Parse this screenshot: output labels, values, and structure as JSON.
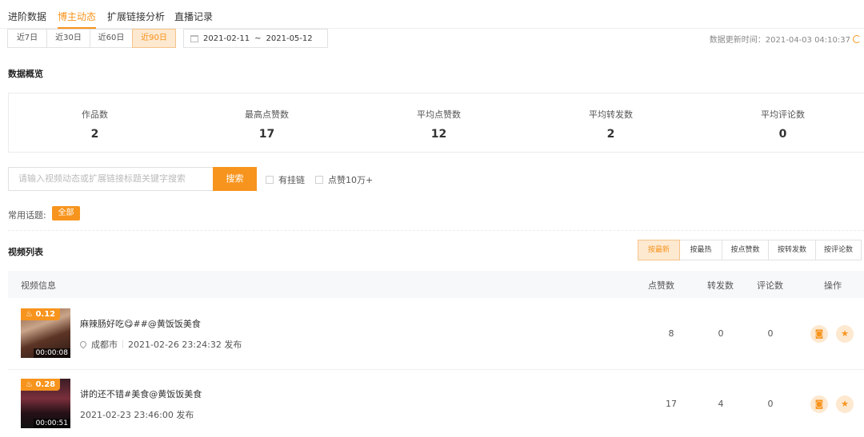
{
  "tabs": [
    "进阶数据",
    "博主动态",
    "扩展链接分析",
    "直播记录"
  ],
  "active_tab": 1,
  "date_ranges": [
    "近7日",
    "近30日",
    "近60日",
    "近90日"
  ],
  "active_range": 3,
  "date_range": {
    "start": "2021-02-11",
    "sep": "~",
    "end": "2021-05-12"
  },
  "update_time": "数据更新时间：2021-04-03 04:10:37",
  "overview": {
    "title": "数据概览",
    "items": [
      {
        "label": "作品数",
        "value": "2"
      },
      {
        "label": "最高点赞数",
        "value": "17"
      },
      {
        "label": "平均点赞数",
        "value": "12"
      },
      {
        "label": "平均转发数",
        "value": "2"
      },
      {
        "label": "平均评论数",
        "value": "0"
      }
    ]
  },
  "search": {
    "placeholder": "请输入视频动态或扩展链接标题关键字搜索",
    "button": "搜索",
    "filter_link": "有挂链",
    "filter_likes": "点赞10万+"
  },
  "topics": {
    "label": "常用话题:",
    "tag": "全部"
  },
  "video_list": {
    "title": "视频列表",
    "sort_options": [
      "按最新",
      "按最热",
      "按点赞数",
      "按转发数",
      "按评论数"
    ],
    "active_sort": 0,
    "headers": {
      "info": "视频信息",
      "likes": "点赞数",
      "shares": "转发数",
      "comments": "评论数",
      "ops": "操作"
    },
    "rows": [
      {
        "badge": "0.12",
        "duration": "00:00:08",
        "title": "麻辣肠好吃😋##@黄饭饭美食",
        "location": "成都市",
        "time": "2021-02-26 23:24:32 发布",
        "likes": "8",
        "shares": "0",
        "comments": "0"
      },
      {
        "badge": "0.28",
        "duration": "00:00:51",
        "title": "讲的还不错#美食@黄饭饭美食",
        "location": "",
        "time": "2021-02-23 23:46:00 发布",
        "likes": "17",
        "shares": "4",
        "comments": "0"
      }
    ]
  },
  "colors": {
    "accent": "#f7941d",
    "accent_light": "#fde8d0"
  },
  "icons": {
    "calendar": "calendar-icon",
    "refresh": "refresh-icon",
    "fire": "fire-icon",
    "location": "location-pin-icon",
    "camera": "camera-icon",
    "star": "star-icon"
  }
}
